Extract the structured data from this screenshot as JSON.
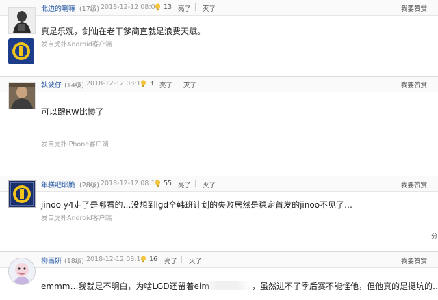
{
  "common": {
    "tip_label": "我要赞赏",
    "light_label": "亮了",
    "dark_label": "灭了"
  },
  "comments": [
    {
      "author": "北边的喇嘛",
      "level": "(17级)",
      "time": "2018-12-12 08:06",
      "lights": "13",
      "content": "真是乐观，剑仙在老干爹简直就是浪费天赋。",
      "source": "发自虎扑Android客户端"
    },
    {
      "author": "執波仔",
      "level": "(14级)",
      "time": "2018-12-12 08:11",
      "lights": "3",
      "content": "可以跟RW比惨了",
      "source": "发自虎扑iPhone客户端"
    },
    {
      "author": "年糕吧耶脆",
      "level": "(28级)",
      "time": "2018-12-12 08:12",
      "lights": "55",
      "content": "jinoo y4走了是哪看的…没想到lgd全韩班计划的失败居然是稳定首发的jinoo不见了…",
      "source": "发自虎扑Android客户端",
      "extra": "分"
    },
    {
      "author": "柳画妍",
      "level": "(18级)",
      "time": "2018-12-12 08:14",
      "lights": "16",
      "content_left": "emmm…我就是不明白，为啥LGD还留着eim",
      "content_right": "，虽然进不了季后赛不能怪他，但他真的是挺坑的…"
    }
  ],
  "colors": {
    "author": "#2d5ea8",
    "header_bg": "#fafafa"
  }
}
